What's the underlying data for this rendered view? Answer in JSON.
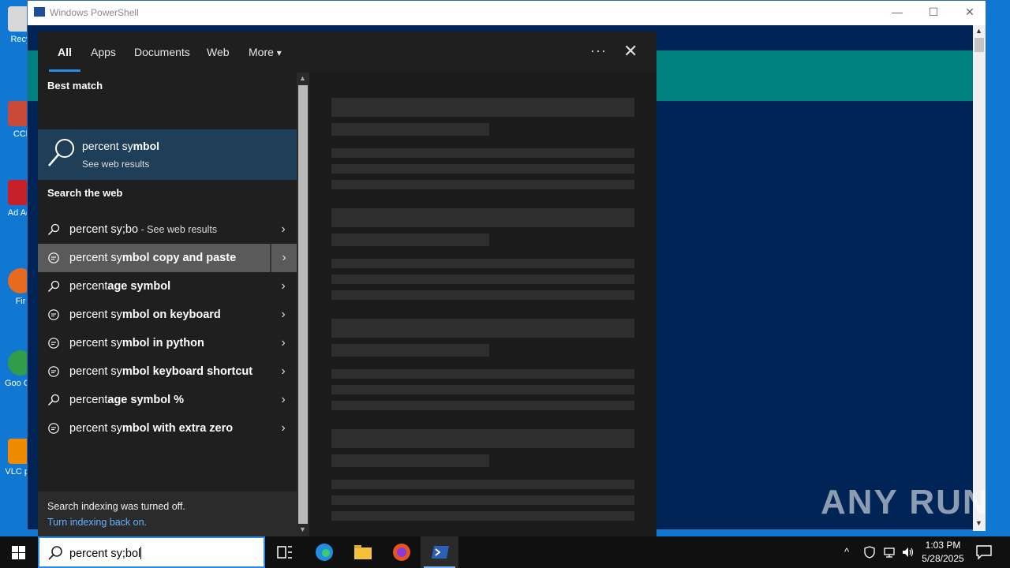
{
  "powershell": {
    "title": "Windows PowerShell",
    "minimize": "—",
    "maximize": "☐",
    "close": "✕"
  },
  "desktop_icons": [
    {
      "label": "Recy",
      "color": "#d8d8d8"
    },
    {
      "label": "CCl",
      "color": "#c84a3a"
    },
    {
      "label": "Ad Acr",
      "color": "#c8202a"
    },
    {
      "label": "Fir",
      "color": "#e86a1e"
    },
    {
      "label": "Goo Chr",
      "color": "#2f9d4a"
    },
    {
      "label": "VLC pla",
      "color": "#f08a00"
    }
  ],
  "search": {
    "tabs": [
      "All",
      "Apps",
      "Documents",
      "Web",
      "More"
    ],
    "more_arrow": "▾",
    "options_dots": "···",
    "close_icon": "✕",
    "best_match_heading": "Best match",
    "best_match": {
      "title_plain": "percent sy",
      "title_bold": "mbol",
      "subtitle": "See web results"
    },
    "web_heading": "Search the web",
    "web_results": [
      {
        "icon": "search-icon",
        "plain": "percent sy;bo",
        "bold": "",
        "suffix": " - See web results",
        "hover": false
      },
      {
        "icon": "suggestion-icon",
        "plain": "percent sy",
        "bold": "mbol copy and paste",
        "suffix": "",
        "hover": true
      },
      {
        "icon": "search-icon",
        "plain": "percent",
        "bold": "age symbol",
        "suffix": "",
        "hover": false
      },
      {
        "icon": "suggestion-icon",
        "plain": "percent sy",
        "bold": "mbol on keyboard",
        "suffix": "",
        "hover": false
      },
      {
        "icon": "suggestion-icon",
        "plain": "percent sy",
        "bold": "mbol in python",
        "suffix": "",
        "hover": false
      },
      {
        "icon": "suggestion-icon",
        "plain": "percent sy",
        "bold": "mbol keyboard shortcut",
        "suffix": "",
        "hover": false
      },
      {
        "icon": "search-icon",
        "plain": "percent",
        "bold": "age symbol %",
        "suffix": "",
        "hover": false
      },
      {
        "icon": "suggestion-icon",
        "plain": "percent sy",
        "bold": "mbol with extra zero",
        "suffix": "",
        "hover": false
      }
    ],
    "chevron": "›",
    "indexing_notice": "Search indexing was turned off.",
    "indexing_link": "Turn indexing back on."
  },
  "taskbar": {
    "search_value": "percent sy;bol",
    "clock_time": "1:03 PM",
    "clock_date": "5/28/2025",
    "tray_chevron": "^"
  },
  "watermark": "ANY RUN"
}
